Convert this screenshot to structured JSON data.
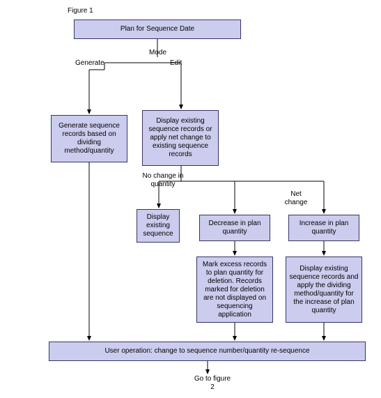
{
  "title": "Figure 1",
  "nodes": {
    "plan": "Plan for Sequence Date",
    "generate_box": "Generate sequence records based on dividing method/quantity",
    "edit_box": "Display existing sequence records or apply net change to existing sequence records",
    "display_existing": "Display existing sequence",
    "decrease": "Decrease in plan quantity",
    "increase": "Increase in plan quantity",
    "mark_excess": "Mark excess records to plan quantity for deletion. Records marked for deletion are not displayed on sequencing application",
    "display_apply": "Display existing sequence records and apply the dividing method/quantity for the increase of plan quantity",
    "user_op": "User operation: change to sequence number/quantity re-sequence"
  },
  "labels": {
    "mode": "Mode",
    "generate": "Generate",
    "edit": "Edit",
    "no_change": "No change in quantity",
    "net_change": "Net change",
    "goto": "Go to figure 2"
  }
}
